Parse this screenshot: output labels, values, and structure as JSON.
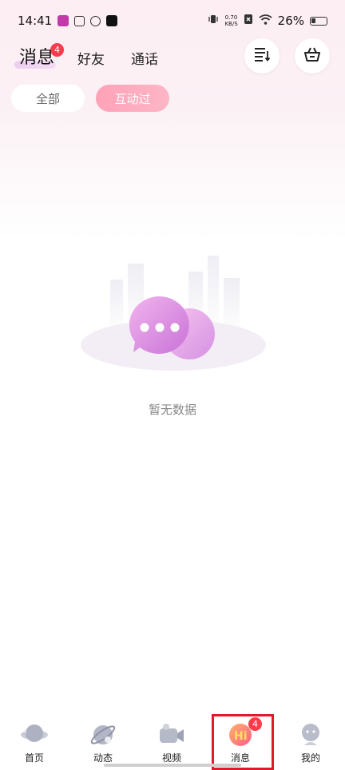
{
  "status_bar": {
    "time": "14:41",
    "net_speed_value": "0.70",
    "net_speed_unit": "KB/S",
    "battery": "26%"
  },
  "header": {
    "tabs": [
      {
        "label": "消息",
        "badge": "4",
        "active": true
      },
      {
        "label": "好友"
      },
      {
        "label": "通话"
      }
    ],
    "icons": [
      "list-sort-icon",
      "basket-icon"
    ]
  },
  "filters": [
    {
      "label": "全部",
      "active": false
    },
    {
      "label": "互动过",
      "active": true
    }
  ],
  "empty_state": {
    "text": "暂无数据"
  },
  "bottom_nav": [
    {
      "label": "首页",
      "icon": "planet-icon"
    },
    {
      "label": "动态",
      "icon": "orbit-icon"
    },
    {
      "label": "视频",
      "icon": "video-camera-icon"
    },
    {
      "label": "消息",
      "icon": "hi-message-icon",
      "badge": "4",
      "active": true
    },
    {
      "label": "我的",
      "icon": "profile-icon"
    }
  ],
  "colors": {
    "accent_pink": "#ffa2b8",
    "badge_red": "#ff3a4a",
    "highlight_red": "#e0192c"
  }
}
